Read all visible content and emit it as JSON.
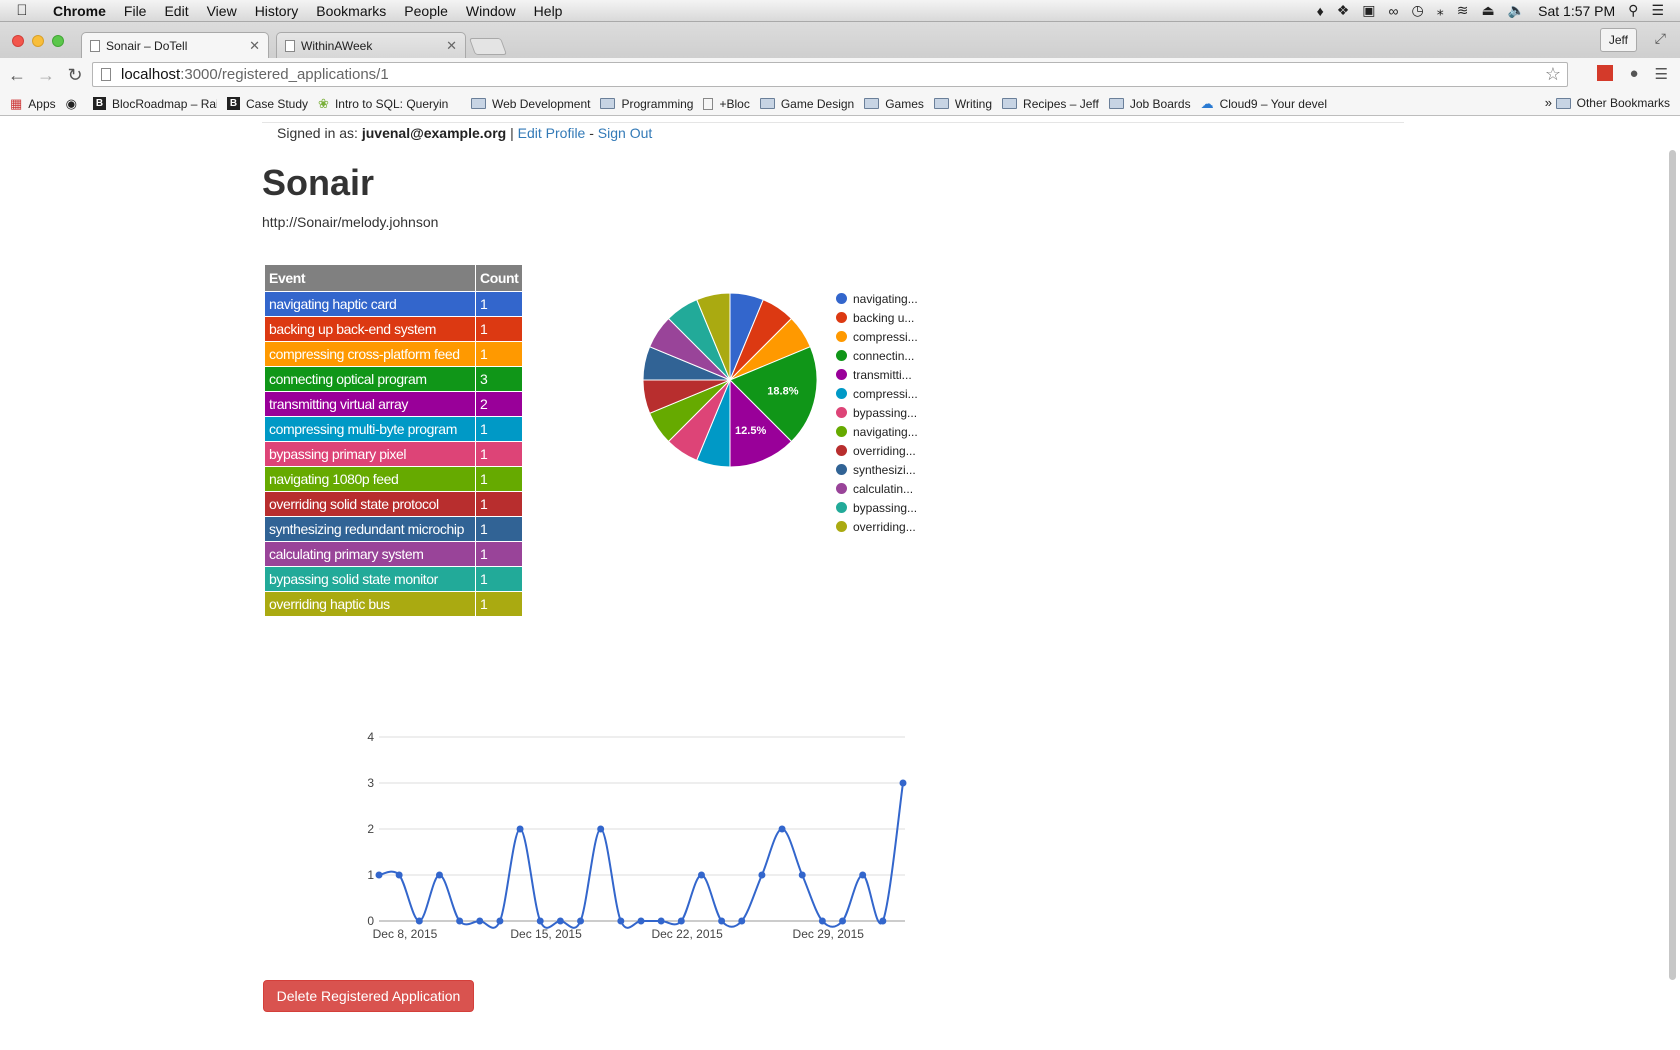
{
  "menubar": {
    "app": "Chrome",
    "items": [
      "File",
      "Edit",
      "View",
      "History",
      "Bookmarks",
      "People",
      "Window",
      "Help"
    ],
    "clock": "Sat 1:57 PM"
  },
  "browser": {
    "tabs": [
      {
        "title": "Sonair – DoTell",
        "active": true
      },
      {
        "title": "WithinAWeek",
        "active": false
      }
    ],
    "profile": "Jeff",
    "url_host": "localhost",
    "url_path": ":3000/registered_applications/1",
    "bookmarks": [
      {
        "label": "Apps",
        "icon": "apps-grid-icon"
      },
      {
        "label": "",
        "icon": "github-icon"
      },
      {
        "label": "BlocRoadmap – Rails",
        "icon": "bloc-icon"
      },
      {
        "label": "Case Study",
        "icon": "bloc-icon"
      },
      {
        "label": "Intro to SQL: Queryin",
        "icon": "leaf-icon"
      },
      {
        "label": "Web Development",
        "icon": "folder-icon"
      },
      {
        "label": "Programming",
        "icon": "folder-icon"
      },
      {
        "label": "+Bloc",
        "icon": "page-icon"
      },
      {
        "label": "Game Design",
        "icon": "folder-icon"
      },
      {
        "label": "Games",
        "icon": "folder-icon"
      },
      {
        "label": "Writing",
        "icon": "folder-icon"
      },
      {
        "label": "Recipes – Jeff",
        "icon": "folder-icon"
      },
      {
        "label": "Job Boards",
        "icon": "folder-icon"
      },
      {
        "label": "Cloud9 – Your devel",
        "icon": "cloud9-icon"
      }
    ],
    "other_bookmarks": "Other Bookmarks"
  },
  "page": {
    "signin_prefix": "Signed in as: ",
    "signin_email": "juvenal@example.org",
    "separator": " | ",
    "edit_profile": "Edit Profile",
    "dash": " - ",
    "sign_out": "Sign Out",
    "title": "Sonair",
    "app_url": "http://Sonair/melody.johnson",
    "table": {
      "headers": [
        "Event",
        "Count"
      ]
    },
    "delete_button": "Delete Registered Application"
  },
  "chart_data": [
    {
      "type": "pie",
      "slices": [
        {
          "label": "navigating haptic card",
          "legend": "navigating...",
          "value": 1,
          "color": "#3366cc"
        },
        {
          "label": "backing up back-end system",
          "legend": "backing u...",
          "value": 1,
          "color": "#dc3912"
        },
        {
          "label": "compressing cross-platform feed",
          "legend": "compressi...",
          "value": 1,
          "color": "#ff9900"
        },
        {
          "label": "connecting optical program",
          "legend": "connectin...",
          "value": 3,
          "color": "#109618",
          "data_label": "18.8%"
        },
        {
          "label": "transmitting virtual array",
          "legend": "transmitti...",
          "value": 2,
          "color": "#990099",
          "data_label": "12.5%"
        },
        {
          "label": "compressing multi-byte program",
          "legend": "compressi...",
          "value": 1,
          "color": "#0099c6"
        },
        {
          "label": "bypassing primary pixel",
          "legend": "bypassing...",
          "value": 1,
          "color": "#dd4477"
        },
        {
          "label": "navigating 1080p feed",
          "legend": "navigating...",
          "value": 1,
          "color": "#66aa00"
        },
        {
          "label": "overriding solid state protocol",
          "legend": "overriding...",
          "value": 1,
          "color": "#b82e2e"
        },
        {
          "label": "synthesizing redundant microchip",
          "legend": "synthesizi...",
          "value": 1,
          "color": "#316395"
        },
        {
          "label": "calculating primary system",
          "legend": "calculatin...",
          "value": 1,
          "color": "#994499"
        },
        {
          "label": "bypassing solid state monitor",
          "legend": "bypassing...",
          "value": 1,
          "color": "#22aa99"
        },
        {
          "label": "overriding haptic bus",
          "legend": "overriding...",
          "value": 1,
          "color": "#aaaa11"
        }
      ],
      "legend_position": "right"
    },
    {
      "type": "line",
      "x": [
        "2015-12-08",
        "2015-12-09",
        "2015-12-10",
        "2015-12-11",
        "2015-12-12",
        "2015-12-13",
        "2015-12-14",
        "2015-12-15",
        "2015-12-16",
        "2015-12-17",
        "2015-12-18",
        "2015-12-19",
        "2015-12-20",
        "2015-12-21",
        "2015-12-22",
        "2015-12-23",
        "2015-12-24",
        "2015-12-25",
        "2015-12-26",
        "2015-12-27",
        "2015-12-28",
        "2015-12-29",
        "2015-12-30",
        "2015-12-31",
        "2016-01-01",
        "2016-01-02",
        "2016-01-03"
      ],
      "values": [
        1,
        1,
        0,
        1,
        0,
        0,
        0,
        2,
        0,
        0,
        0,
        2,
        0,
        0,
        0,
        0,
        1,
        0,
        0,
        1,
        2,
        1,
        0,
        0,
        1,
        0,
        3
      ],
      "x_ticks": [
        "Dec 8, 2015",
        "Dec 15, 2015",
        "Dec 22, 2015",
        "Dec 29, 2015"
      ],
      "y_ticks": [
        "0",
        "1",
        "2",
        "3",
        "4"
      ],
      "ylim": [
        0,
        4
      ],
      "color": "#3366cc",
      "grid": true
    }
  ]
}
